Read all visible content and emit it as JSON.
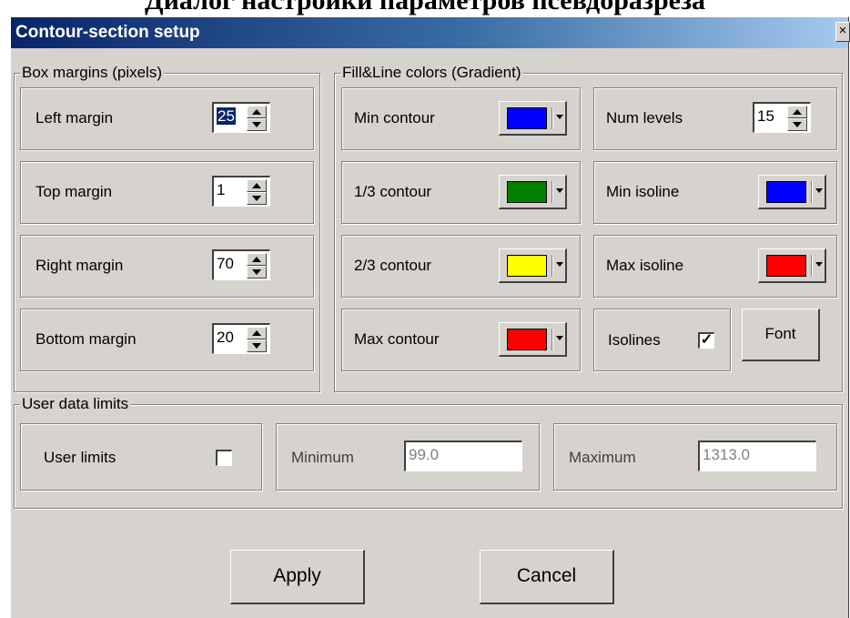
{
  "document": {
    "caption": "Диалог настройки параметров псевдоразреза"
  },
  "window": {
    "title": "Contour-section setup",
    "close_glyph": "×"
  },
  "box_margins": {
    "legend": "Box margins (pixels)",
    "rows": [
      {
        "label": "Left margin",
        "value": "25",
        "selected": true
      },
      {
        "label": "Top margin",
        "value": "1"
      },
      {
        "label": "Right margin",
        "value": "70"
      },
      {
        "label": "Bottom margin",
        "value": "20"
      }
    ]
  },
  "fill_line": {
    "legend": "Fill&Line colors (Gradient)",
    "contours": [
      {
        "label": "Min contour",
        "color": "#0000ff"
      },
      {
        "label": "1/3 contour",
        "color": "#008000"
      },
      {
        "label": "2/3 contour",
        "color": "#ffff00"
      },
      {
        "label": "Max contour",
        "color": "#ff0000"
      }
    ],
    "num_levels": {
      "label": "Num levels",
      "value": "15"
    },
    "min_isoline": {
      "label": "Min isoline",
      "color": "#0000ff"
    },
    "max_isoline": {
      "label": "Max isoline",
      "color": "#ff0000"
    },
    "isolines": {
      "label": "Isolines",
      "checked": true,
      "check_glyph": "✓"
    },
    "font_button": "Font"
  },
  "user_limits": {
    "legend": "User data limits",
    "user_limits": {
      "label": "User limits",
      "checked": false
    },
    "minimum": {
      "label": "Minimum",
      "value": "99.0"
    },
    "maximum": {
      "label": "Maximum",
      "value": "1313.0"
    }
  },
  "buttons": {
    "apply": "Apply",
    "cancel": "Cancel"
  }
}
